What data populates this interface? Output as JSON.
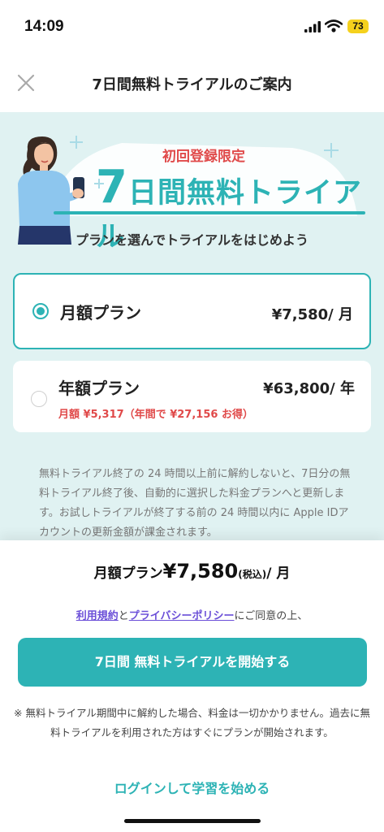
{
  "status_bar": {
    "time": "14:09",
    "battery": "73"
  },
  "header": {
    "title": "7日間無料トライアルのご案内"
  },
  "hero": {
    "subtitle": "初回登録限定",
    "title_num": "7",
    "title_rest": "日間無料トライアル",
    "caption": "プランを選んでトライアルをはじめよう"
  },
  "plans": [
    {
      "name": "月額プラン",
      "price": "¥7,580/ 月",
      "selected": true
    },
    {
      "name": "年額プラン",
      "price": "¥63,800/ 年",
      "sub": "月額 ¥5,317（年間で ¥27,156 お得）",
      "selected": false
    }
  ],
  "notice": "無料トライアル終了の 24 時間以上前に解約しないと、7日分の無料トライアル終了後、自動的に選択した料金プランへと更新します。お試しトライアルが終了する前の 24 時間以内に Apple IDアカウントの更新金額が課金されます。",
  "summary": {
    "label": "月額プラン",
    "amount": "¥7,580",
    "tax": "(税込)",
    "per": "/ 月"
  },
  "agreement": {
    "terms": "利用規約",
    "and": "と",
    "privacy": "プライバシーポリシー",
    "suffix": "にご同意の上、"
  },
  "cta_label": "7日間 無料トライアルを開始する",
  "footnote": "※ 無料トライアル期間中に解約した場合、料金は一切かかりません。過去に無料トライアルを利用された方はすぐにプランが開始されます。",
  "login_link": "ログインして学習を始める",
  "colors": {
    "accent": "#2db3b5",
    "alert": "#e04a4a",
    "link": "#6b4fd8",
    "content_bg": "#e0f2f2"
  }
}
